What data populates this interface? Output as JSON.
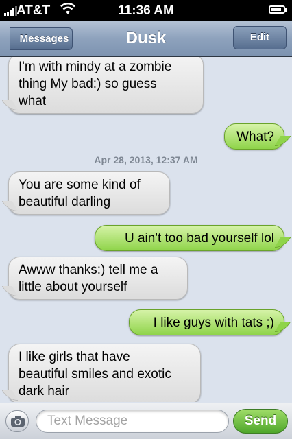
{
  "status_bar": {
    "carrier": "AT&T",
    "time": "11:36 AM"
  },
  "nav": {
    "back_label": "Messages",
    "title": "Dusk",
    "edit_label": "Edit"
  },
  "thread": {
    "timestamp": "Apr 28, 2013, 12:37 AM",
    "messages": [
      {
        "direction": "incoming",
        "lines": [
          "I'm with mindy at a zombie",
          "thing My bad:) so guess",
          "what"
        ]
      },
      {
        "direction": "outgoing",
        "lines": [
          "What?"
        ]
      },
      {
        "direction": "incoming",
        "lines": [
          "You are some kind of",
          "beautiful darling"
        ]
      },
      {
        "direction": "outgoing",
        "lines": [
          "U ain't too bad yourself lol"
        ]
      },
      {
        "direction": "incoming",
        "lines": [
          "Awww thanks:) tell me a",
          "little about yourself"
        ]
      },
      {
        "direction": "outgoing",
        "lines": [
          "I like guys with tats ;)"
        ]
      },
      {
        "direction": "incoming",
        "lines": [
          "I like girls that have",
          "beautiful smiles and exotic",
          "dark hair"
        ]
      }
    ]
  },
  "compose": {
    "placeholder": "Text Message",
    "send_label": "Send"
  },
  "colors": {
    "incoming_bubble": "#dcdcdc",
    "outgoing_bubble": "#8fd44a",
    "background": "#dbe2ed"
  }
}
